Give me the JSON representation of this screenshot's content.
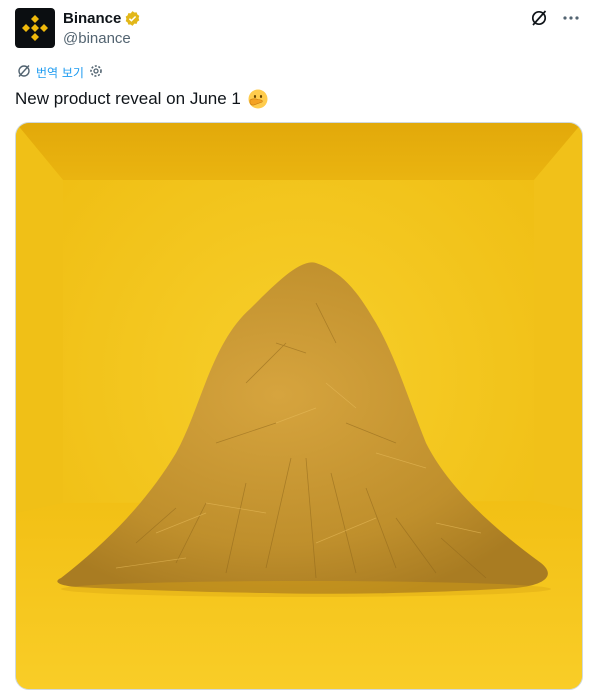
{
  "author": {
    "display_name": "Binance",
    "handle": "@binance",
    "verified_icon": "gold-verified-badge-icon"
  },
  "header_actions": {
    "grok_icon": "slash-circle-icon",
    "more_icon": "more-dots-icon"
  },
  "translate": {
    "label": "번역 보기",
    "icon": "translate-icon",
    "settings_icon": "gear-icon"
  },
  "tweet": {
    "text": "New product reveal on June 1",
    "emoji": "face-with-hand-over-mouth-emoji"
  },
  "media": {
    "description_icon": "image",
    "colors": {
      "wall": "#f5c518",
      "floor": "#f8ca1e",
      "haystack": "#c8962a"
    }
  }
}
